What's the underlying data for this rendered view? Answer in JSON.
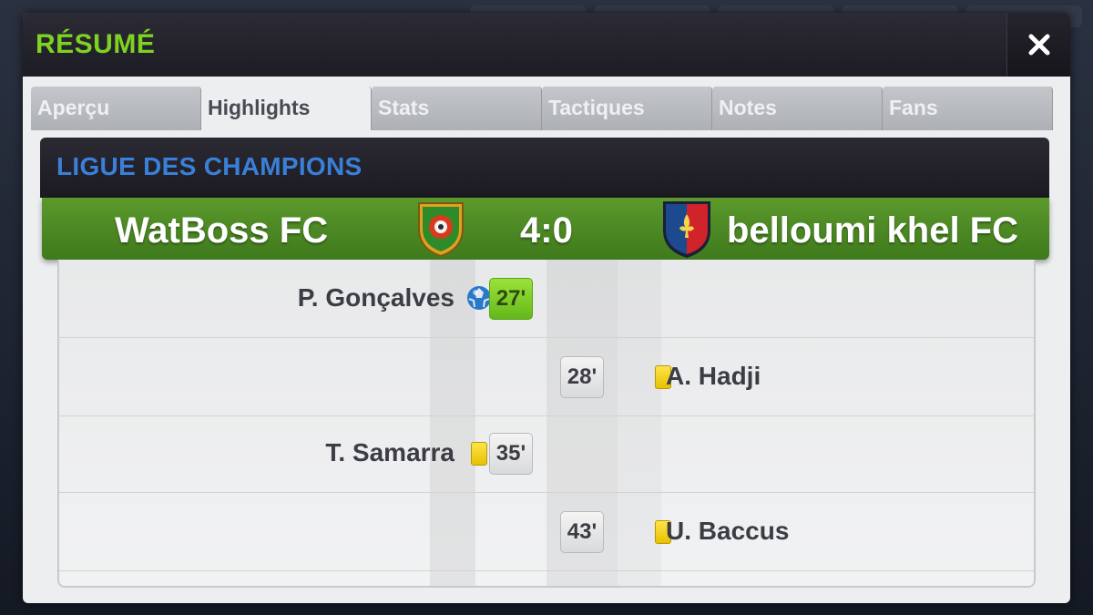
{
  "modal": {
    "title": "RÉSUMÉ",
    "close_icon": "close-icon"
  },
  "tabs": [
    {
      "label": "Aperçu"
    },
    {
      "label": "Highlights"
    },
    {
      "label": "Stats"
    },
    {
      "label": "Tactiques"
    },
    {
      "label": "Notes"
    },
    {
      "label": "Fans"
    }
  ],
  "active_tab": "Highlights",
  "competition": "LIGUE DES CHAMPIONS",
  "match": {
    "home_team": "WatBoss FC",
    "away_team": "belloumi khel FC",
    "score": "4:0",
    "home_crest_icon": "shield-crest-green-icon",
    "away_crest_icon": "shield-crest-blue-red-fleur-icon"
  },
  "events": [
    {
      "side": "home",
      "player": "P. Gonçalves",
      "minute": "27'",
      "type": "goal",
      "icon": "soccer-ball-icon"
    },
    {
      "side": "away",
      "player": "A. Hadji",
      "minute": "28'",
      "type": "yellow_card",
      "icon": "yellow-card-icon"
    },
    {
      "side": "home",
      "player": "T. Samarra",
      "minute": "35'",
      "type": "yellow_card",
      "icon": "yellow-card-icon"
    },
    {
      "side": "away",
      "player": "U. Baccus",
      "minute": "43'",
      "type": "yellow_card",
      "icon": "yellow-card-icon"
    }
  ],
  "colors": {
    "title_green": "#7ed321",
    "league_blue": "#3a7fd8",
    "goal_green": "#64b81b",
    "yellow_card": "#ffe44a"
  }
}
